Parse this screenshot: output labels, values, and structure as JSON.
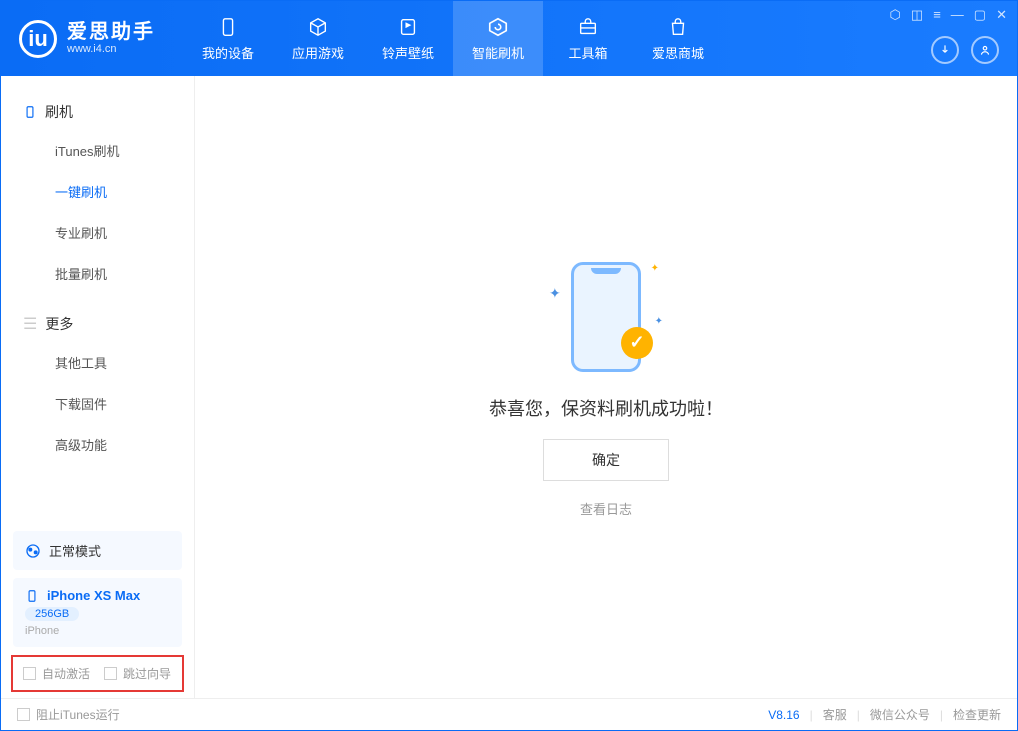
{
  "app": {
    "name_cn": "爱思助手",
    "url": "www.i4.cn"
  },
  "nav": {
    "items": [
      {
        "label": "我的设备"
      },
      {
        "label": "应用游戏"
      },
      {
        "label": "铃声壁纸"
      },
      {
        "label": "智能刷机"
      },
      {
        "label": "工具箱"
      },
      {
        "label": "爱思商城"
      }
    ]
  },
  "sidebar": {
    "section1_title": "刷机",
    "section1_items": [
      {
        "label": "iTunes刷机"
      },
      {
        "label": "一键刷机"
      },
      {
        "label": "专业刷机"
      },
      {
        "label": "批量刷机"
      }
    ],
    "section2_title": "更多",
    "section2_items": [
      {
        "label": "其他工具"
      },
      {
        "label": "下载固件"
      },
      {
        "label": "高级功能"
      }
    ],
    "mode_label": "正常模式",
    "device": {
      "name": "iPhone XS Max",
      "capacity": "256GB",
      "type": "iPhone"
    },
    "options": {
      "auto_activate": "自动激活",
      "skip_guide": "跳过向导"
    }
  },
  "main": {
    "success_text": "恭喜您，保资料刷机成功啦！",
    "ok_button": "确定",
    "view_log": "查看日志"
  },
  "footer": {
    "block_itunes": "阻止iTunes运行",
    "version": "V8.16",
    "links": {
      "support": "客服",
      "wechat": "微信公众号",
      "update": "检查更新"
    }
  }
}
